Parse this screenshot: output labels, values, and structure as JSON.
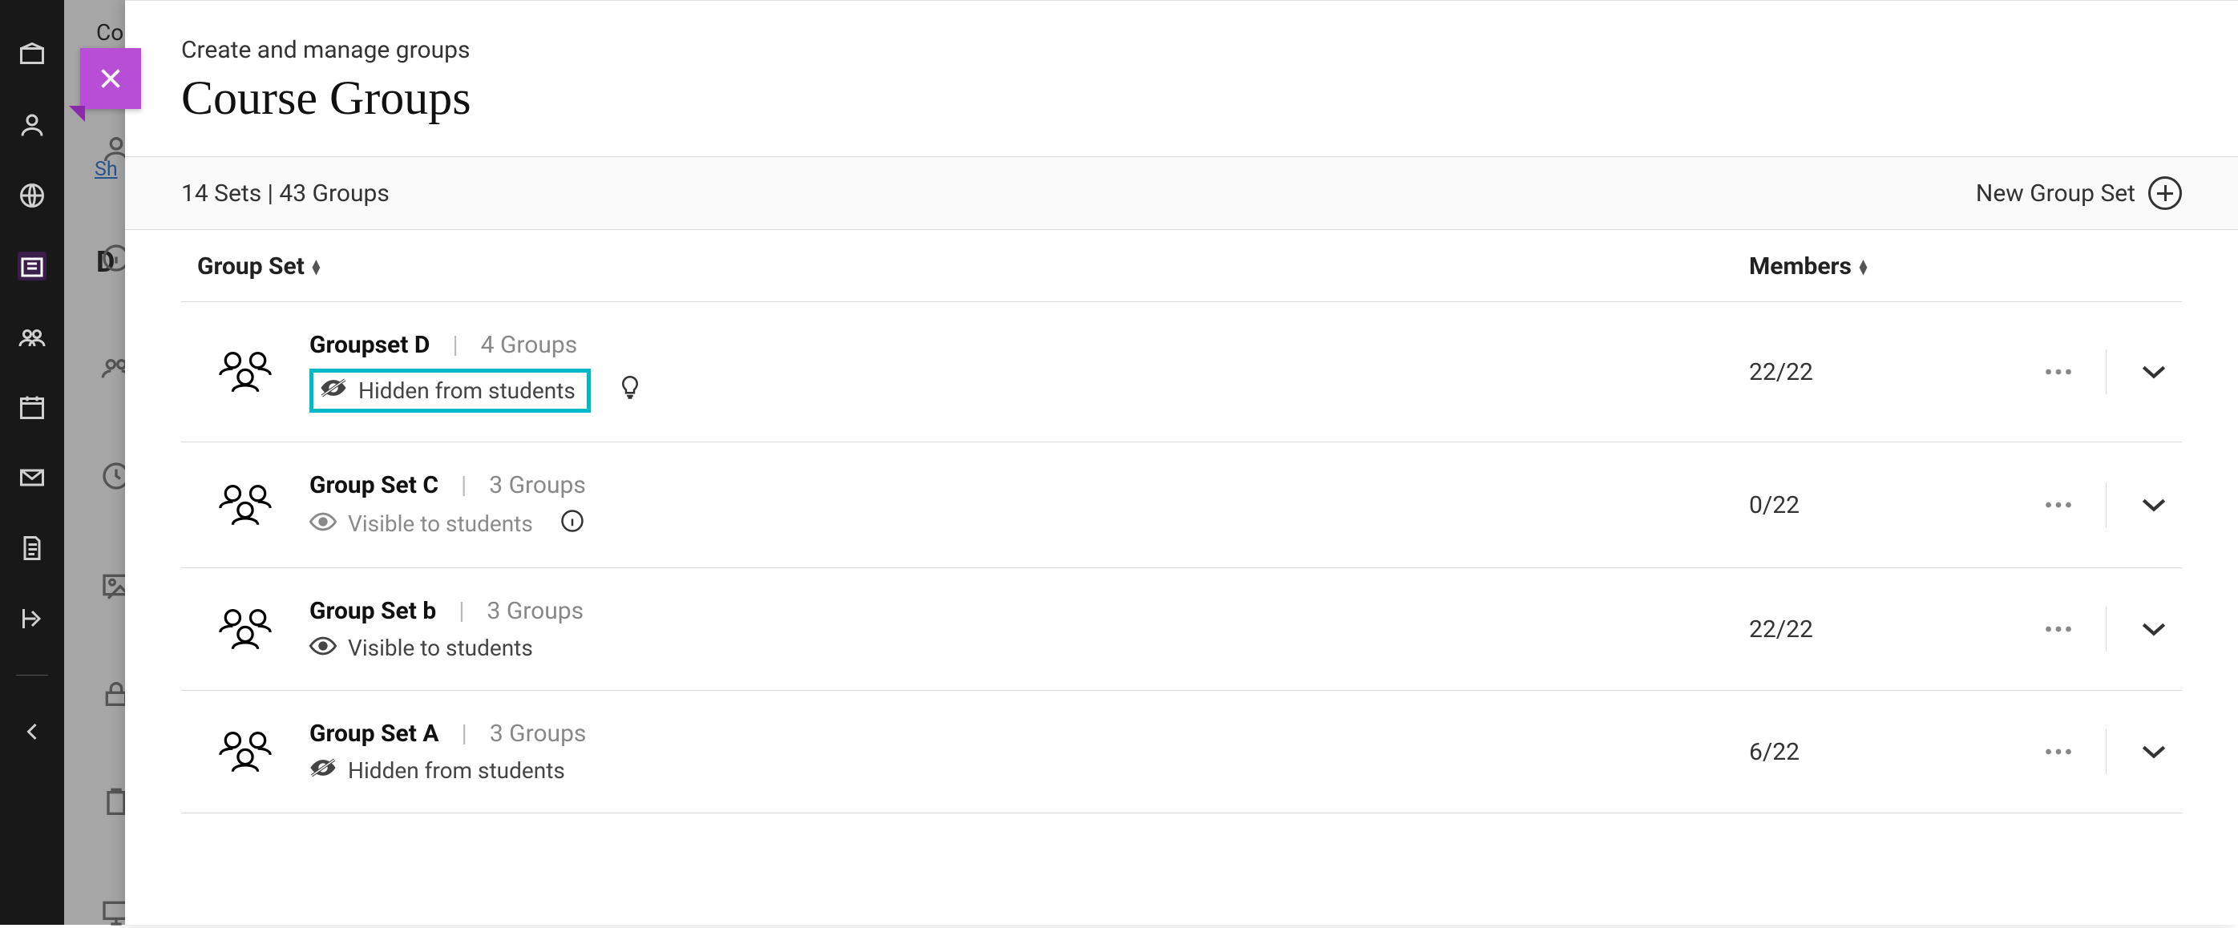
{
  "rail": {
    "items": [
      "logo",
      "profile",
      "globe",
      "institution",
      "groups",
      "calendar",
      "mail",
      "doc",
      "share",
      "back"
    ]
  },
  "peek": {
    "co": "Co",
    "sh": "Sh",
    "d": "D"
  },
  "header": {
    "subtitle": "Create and manage groups",
    "title": "Course Groups"
  },
  "summary": {
    "text": "14 Sets | 43 Groups",
    "new_label": "New Group Set"
  },
  "columns": {
    "groupset": "Group Set",
    "members": "Members"
  },
  "rows": [
    {
      "name": "Groupset D",
      "count_label": "4 Groups",
      "visibility_text": "Hidden from students",
      "visibility_kind": "hidden",
      "highlight": true,
      "extra_icon": "bulb",
      "members": "22/22"
    },
    {
      "name": "Group Set C",
      "count_label": "3 Groups",
      "visibility_text": "Visible to students",
      "visibility_kind": "visible-dim",
      "highlight": false,
      "extra_icon": "info",
      "members": "0/22"
    },
    {
      "name": "Group Set b",
      "count_label": "3 Groups",
      "visibility_text": "Visible to students",
      "visibility_kind": "visible",
      "highlight": false,
      "extra_icon": null,
      "members": "22/22"
    },
    {
      "name": "Group Set A",
      "count_label": "3 Groups",
      "visibility_text": "Hidden from students",
      "visibility_kind": "hidden",
      "highlight": false,
      "extra_icon": null,
      "members": "6/22"
    }
  ]
}
